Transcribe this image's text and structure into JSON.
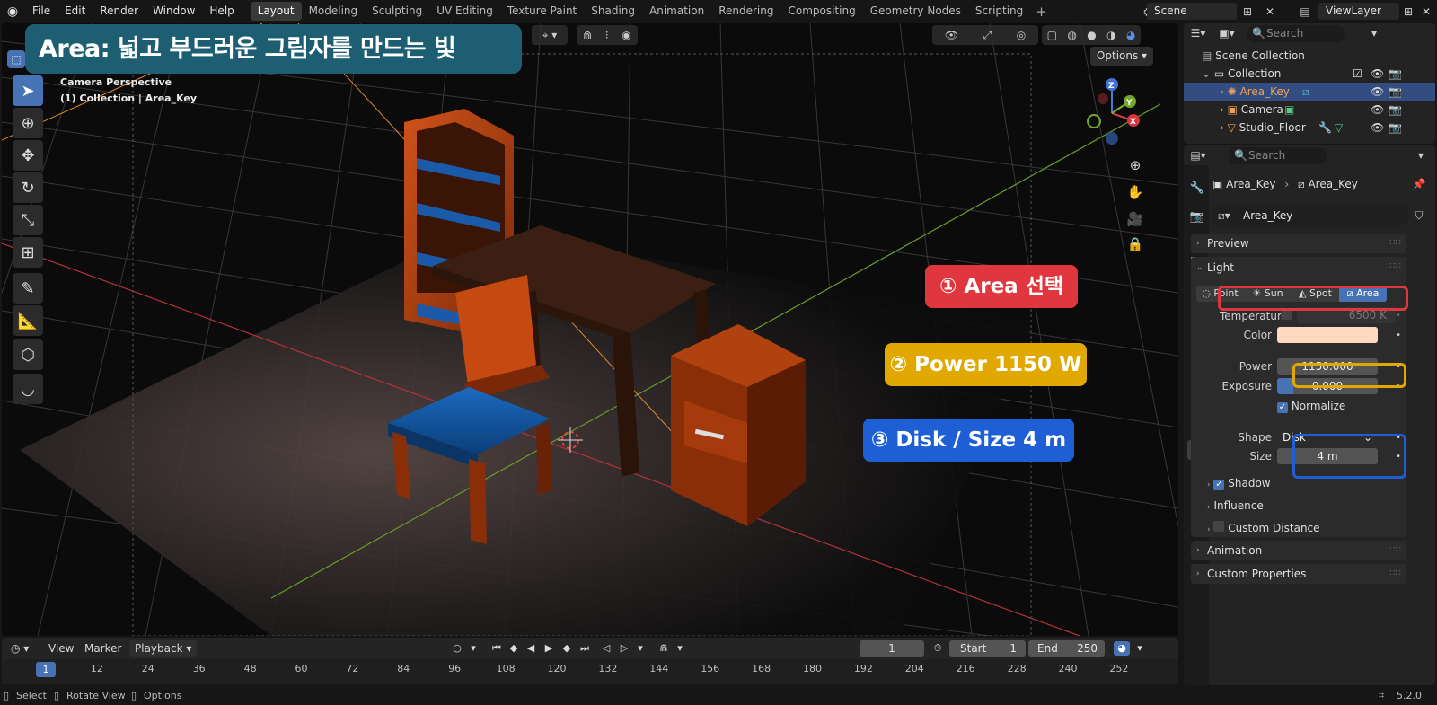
{
  "topbar": {
    "menus": [
      "File",
      "Edit",
      "Render",
      "Window",
      "Help"
    ],
    "workspaces": [
      "Layout",
      "Modeling",
      "Sculpting",
      "UV Editing",
      "Texture Paint",
      "Shading",
      "Animation",
      "Rendering",
      "Compositing",
      "Geometry Nodes",
      "Scripting"
    ],
    "active_workspace": "Layout",
    "scene": "Scene",
    "view_layer": "ViewLayer"
  },
  "viewport": {
    "banner": "Area: 넓고 부드러운 그림자를 만드는 빛",
    "camera_perspective": "Camera Perspective",
    "collection_info": "(1) Collection | Area_Key",
    "options_label": "Options",
    "gizmo_axes": {
      "x": "X",
      "y": "Y",
      "z": "Z"
    }
  },
  "callouts": {
    "step1": "① Area 선택",
    "step2": "② Power 1150 W",
    "step3": "③ Disk / Size 4 m",
    "colors": {
      "red": "#e0373e",
      "yellow": "#e0a800",
      "blue": "#1f5fd6"
    }
  },
  "timeline": {
    "view": "View",
    "marker": "Marker",
    "playback": "Playback",
    "current_frame": "1",
    "start_label": "Start",
    "start": "1",
    "end_label": "End",
    "end": "250",
    "ticks": [
      "1",
      "12",
      "24",
      "36",
      "48",
      "60",
      "72",
      "84",
      "96",
      "108",
      "120",
      "132",
      "144",
      "156",
      "168",
      "180",
      "192",
      "204",
      "216",
      "228",
      "240",
      "252"
    ]
  },
  "statusbar": {
    "select": "Select",
    "rotate_view": "Rotate View",
    "options": "Options",
    "version": "5.2.0"
  },
  "outliner": {
    "search_placeholder": "Search",
    "scene_collection": "Scene Collection",
    "collection": "Collection",
    "items": [
      "Area_Key",
      "Camera",
      "Studio_Floor"
    ]
  },
  "properties": {
    "search_placeholder": "Search",
    "breadcrumb_object": "Area_Key",
    "breadcrumb_data": "Area_Key",
    "datablock_name": "Area_Key",
    "panels": {
      "preview": "Preview",
      "light": "Light",
      "shadow": "Shadow",
      "influence": "Influence",
      "custom_distance": "Custom Distance",
      "animation": "Animation",
      "custom_properties": "Custom Properties"
    },
    "light_types": [
      "Point",
      "Sun",
      "Spot",
      "Area"
    ],
    "active_light_type": "Area",
    "temperature_label": "Temperature",
    "temperature_value": "6500 K",
    "color_label": "Color",
    "color_value": "#ffd9bf",
    "power_label": "Power",
    "power_value": "1150.000",
    "exposure_label": "Exposure",
    "exposure_value": "0.000",
    "normalize_label": "Normalize",
    "shape_label": "Shape",
    "shape_value": "Disk",
    "size_label": "Size",
    "size_value": "4 m"
  }
}
